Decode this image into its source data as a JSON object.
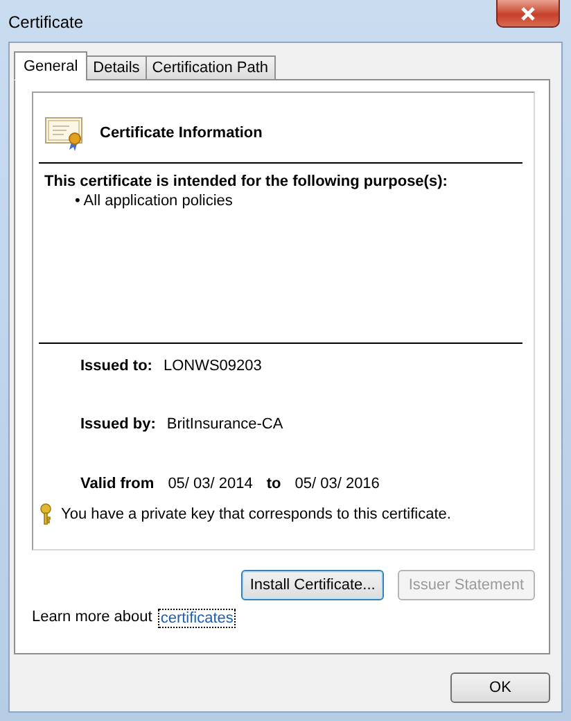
{
  "window": {
    "title": "Certificate"
  },
  "tabs": [
    {
      "label": "General",
      "selected": true
    },
    {
      "label": "Details",
      "selected": false
    },
    {
      "label": "Certification Path",
      "selected": false
    }
  ],
  "info": {
    "heading": "Certificate Information",
    "purpose_heading": "This certificate is intended for the following purpose(s):",
    "purposes": [
      "• All application policies"
    ],
    "issued_to": {
      "label": "Issued to:",
      "value": "LONWS09203"
    },
    "issued_by": {
      "label": "Issued by:",
      "value": "BritInsurance-CA"
    },
    "validity": {
      "label": "Valid from",
      "from": "05/ 03/ 2014",
      "to_label": "to",
      "to": "05/ 03/ 2016"
    },
    "key_note": "You have a private key that corresponds to this certificate."
  },
  "buttons": [
    {
      "label": "Install Certificate...",
      "focused": true,
      "disabled": false
    },
    {
      "label": "Issuer Statement",
      "focused": false,
      "disabled": true
    }
  ],
  "learn_more": {
    "text": "Learn more about",
    "link": "certificates"
  },
  "ok_button": {
    "label": "OK"
  }
}
